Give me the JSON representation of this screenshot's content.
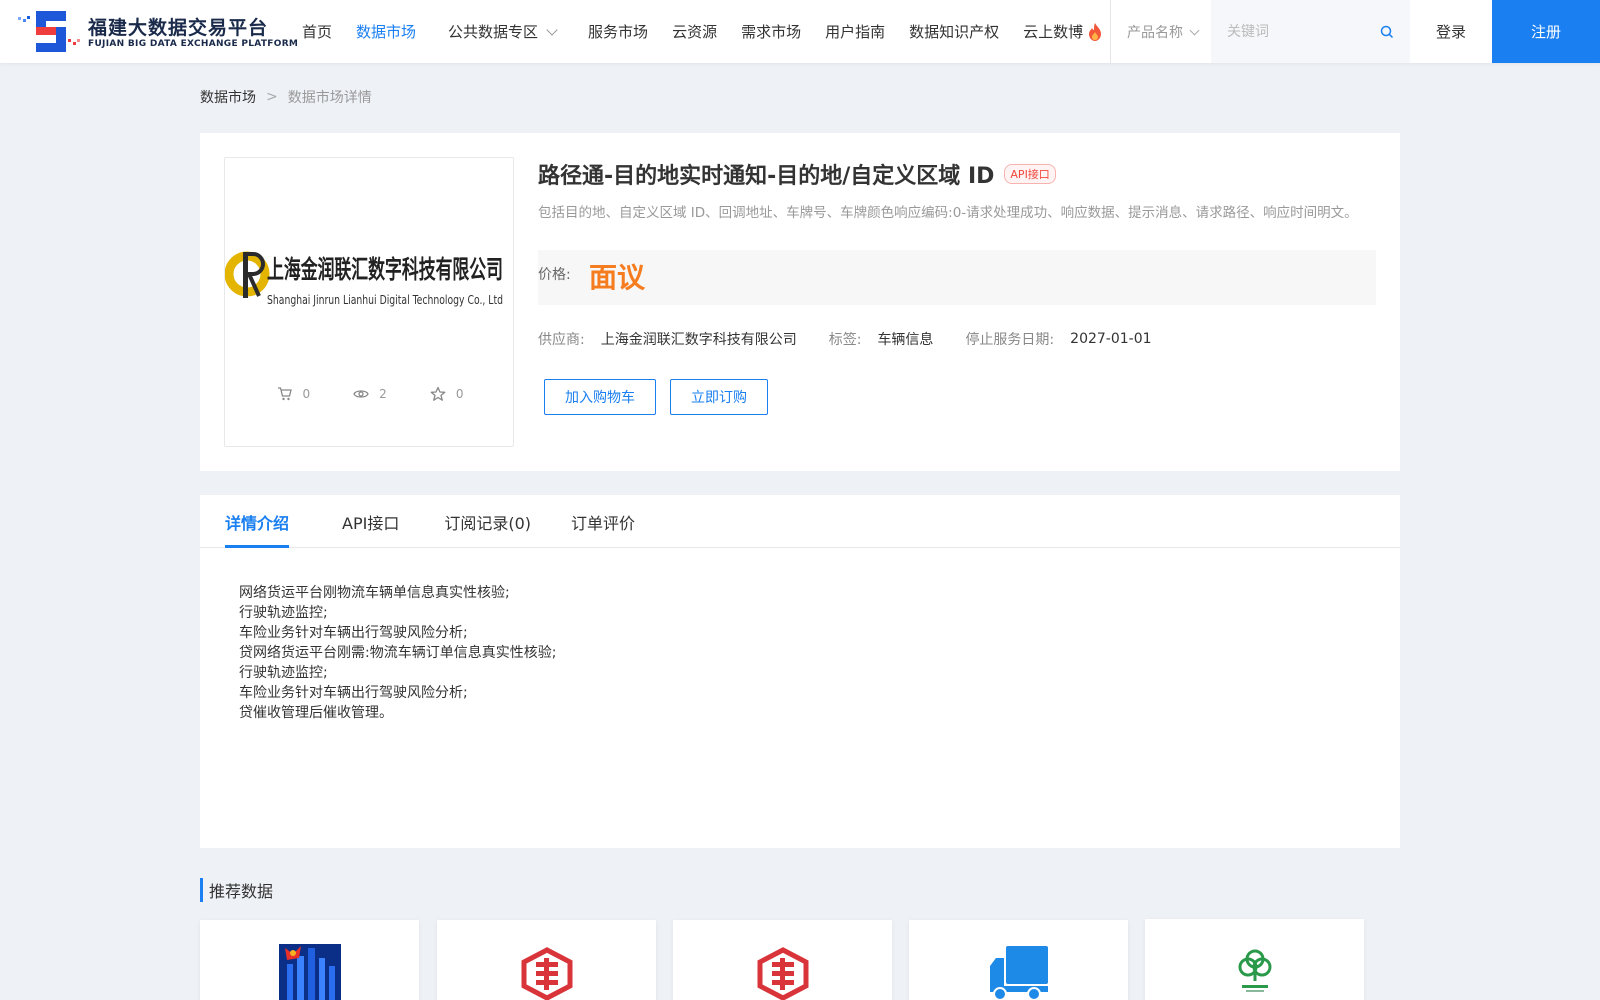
{
  "header": {
    "logo_title": "福建大数据交易平台",
    "logo_subtitle": "FUJIAN BIG DATA EXCHANGE PLATFORM",
    "nav": [
      {
        "label": "首页",
        "active": false
      },
      {
        "label": "数据市场",
        "active": true
      },
      {
        "label": "公共数据专区",
        "active": false,
        "dropdown": true
      },
      {
        "label": "服务市场",
        "active": false
      },
      {
        "label": "云资源",
        "active": false
      },
      {
        "label": "需求市场",
        "active": false
      },
      {
        "label": "用户指南",
        "active": false
      },
      {
        "label": "数据知识产权",
        "active": false
      },
      {
        "label": "云上数博",
        "active": false,
        "hot": true
      }
    ],
    "search": {
      "category": "产品名称",
      "placeholder": "关键词"
    },
    "login_label": "登录",
    "register_label": "注册",
    "accent_color": "#1a7ff0"
  },
  "breadcrumb": {
    "root": "数据市场",
    "separator": ">",
    "current": "数据市场详情"
  },
  "product": {
    "company_logo_cn": "上海金润联汇数字科技有限公司",
    "company_logo_en": "Shanghai Jinrun Lianhui Digital Technology Co., Ltd",
    "stats": {
      "cart": "0",
      "views": "2",
      "favorites": "0"
    },
    "title": "路径通-目的地实时通知-目的地/自定义区域 ID",
    "badge": "API接口",
    "description": "包括目的地、自定义区域 ID、回调地址、车牌号、车牌颜色响应编码:0-请求处理成功、响应数据、提示消息、请求路径、响应时间明文。",
    "price_label": "价格:",
    "price_value": "面议",
    "price_color": "#f57c1f",
    "supplier_label": "供应商:",
    "supplier_value": "上海金润联汇数字科技有限公司",
    "tag_label": "标签:",
    "tag_value": "车辆信息",
    "end_date_label": "停止服务日期:",
    "end_date_value": "2027-01-01",
    "add_cart_label": "加入购物车",
    "buy_now_label": "立即订购"
  },
  "tabs": [
    {
      "label": "详情介绍",
      "active": true
    },
    {
      "label": "API接口",
      "active": false
    },
    {
      "label": "订阅记录(0)",
      "active": false
    },
    {
      "label": "订单评价",
      "active": false
    }
  ],
  "detail_lines": [
    "网络货运平台刚物流车辆单信息真实性核验;",
    "行驶轨迹监控;",
    "车险业务针对车辆出行驾驶风险分析;",
    "贷网络货运平台刚需:物流车辆订单信息真实性核验;",
    "行驶轨迹监控;",
    "车险业务针对车辆出行驾驶风险分析;",
    "贷催收管理后催收管理。"
  ],
  "recommend": {
    "title": "推荐数据",
    "cards": [
      {
        "icon": "city-flag-icon"
      },
      {
        "icon": "red-seal-icon"
      },
      {
        "icon": "red-seal-icon"
      },
      {
        "icon": "truck-icon"
      },
      {
        "icon": "green-tree-logo-icon"
      }
    ]
  }
}
